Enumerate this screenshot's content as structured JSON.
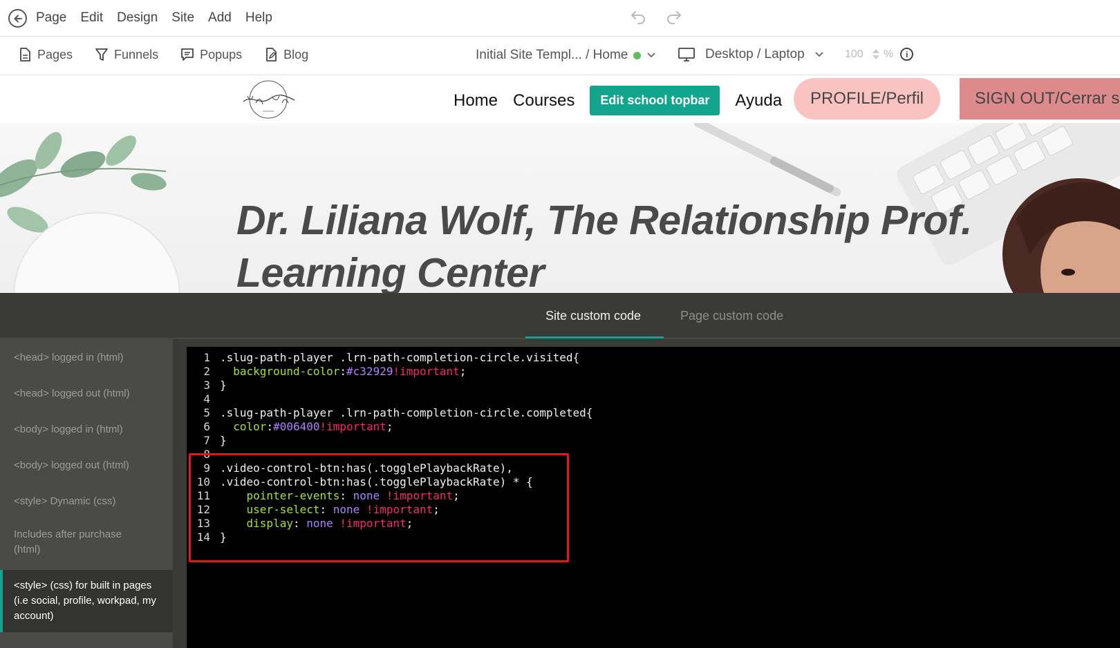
{
  "menubar": {
    "items": [
      "Page",
      "Edit",
      "Design",
      "Site",
      "Add",
      "Help"
    ]
  },
  "toolbar": {
    "items": [
      "Pages",
      "Funnels",
      "Popups",
      "Blog"
    ],
    "site_selector": "Initial Site Templ... / Home",
    "device": "Desktop / Laptop",
    "zoom": "100",
    "zoom_unit": "%",
    "status_color": "#5cc05c"
  },
  "site_nav": {
    "links": [
      "Home",
      "Courses"
    ],
    "edit_topbar": "Edit school topbar",
    "help_link": "Ayuda",
    "profile": "PROFILE/Perfil",
    "signout": "SIGN OUT/Cerrar s"
  },
  "hero": {
    "line1": "Dr. Liliana Wolf, The Relationship Prof.",
    "line2": "Learning Center"
  },
  "panel": {
    "tabs": [
      "Site custom code",
      "Page custom code"
    ],
    "active_tab": "Site custom code",
    "accent_color": "#11a58d",
    "sidebar": [
      "<head> logged in (html)",
      "<head> logged out (html)",
      "<body> logged in (html)",
      "<body> logged out (html)",
      "<style> Dynamic (css)",
      "Includes after purchase (html)",
      "<style> (css) for built in pages (i.e social, profile, workpad, my account)"
    ],
    "active_sidebar_item": "<style> (css) for built in pages (i.e social, profile, workpad, my account)"
  },
  "editor": {
    "lines": [
      {
        "n": "1",
        "segments": [
          {
            "t": ".slug-path-player .lrn-path-completion-circle.visited{",
            "c": ""
          }
        ]
      },
      {
        "n": "2",
        "segments": [
          {
            "t": "  ",
            "c": ""
          },
          {
            "t": "background-color",
            "c": "c-prop"
          },
          {
            "t": ":",
            "c": ""
          },
          {
            "t": "#c32929",
            "c": "c-val"
          },
          {
            "t": "!important",
            "c": "c-imp"
          },
          {
            "t": ";",
            "c": ""
          }
        ]
      },
      {
        "n": "3",
        "segments": [
          {
            "t": "}",
            "c": ""
          }
        ]
      },
      {
        "n": "4",
        "segments": []
      },
      {
        "n": "5",
        "segments": [
          {
            "t": ".slug-path-player .lrn-path-completion-circle.completed{",
            "c": ""
          }
        ]
      },
      {
        "n": "6",
        "segments": [
          {
            "t": "  ",
            "c": ""
          },
          {
            "t": "color",
            "c": "c-prop"
          },
          {
            "t": ":",
            "c": ""
          },
          {
            "t": "#006400",
            "c": "c-val"
          },
          {
            "t": "!important",
            "c": "c-imp"
          },
          {
            "t": ";",
            "c": ""
          }
        ]
      },
      {
        "n": "7",
        "segments": [
          {
            "t": "}",
            "c": ""
          }
        ]
      },
      {
        "n": "8",
        "segments": []
      },
      {
        "n": "9",
        "segments": [
          {
            "t": ".video-control-btn:has(.togglePlaybackRate),",
            "c": ""
          }
        ]
      },
      {
        "n": "10",
        "segments": [
          {
            "t": ".video-control-btn:has(.togglePlaybackRate) * {",
            "c": ""
          }
        ]
      },
      {
        "n": "11",
        "segments": [
          {
            "t": "    ",
            "c": ""
          },
          {
            "t": "pointer-events",
            "c": "c-prop"
          },
          {
            "t": ": ",
            "c": ""
          },
          {
            "t": "none",
            "c": "c-val"
          },
          {
            "t": " ",
            "c": ""
          },
          {
            "t": "!important",
            "c": "c-imp"
          },
          {
            "t": ";",
            "c": ""
          }
        ]
      },
      {
        "n": "12",
        "segments": [
          {
            "t": "    ",
            "c": ""
          },
          {
            "t": "user-select",
            "c": "c-prop"
          },
          {
            "t": ": ",
            "c": ""
          },
          {
            "t": "none",
            "c": "c-val"
          },
          {
            "t": " ",
            "c": ""
          },
          {
            "t": "!important",
            "c": "c-imp"
          },
          {
            "t": ";",
            "c": ""
          }
        ]
      },
      {
        "n": "13",
        "segments": [
          {
            "t": "    ",
            "c": ""
          },
          {
            "t": "display",
            "c": "c-prop"
          },
          {
            "t": ": ",
            "c": ""
          },
          {
            "t": "none",
            "c": "c-val"
          },
          {
            "t": " ",
            "c": ""
          },
          {
            "t": "!important",
            "c": "c-imp"
          },
          {
            "t": ";",
            "c": ""
          }
        ]
      },
      {
        "n": "14",
        "segments": [
          {
            "t": "}",
            "c": ""
          }
        ]
      }
    ]
  }
}
